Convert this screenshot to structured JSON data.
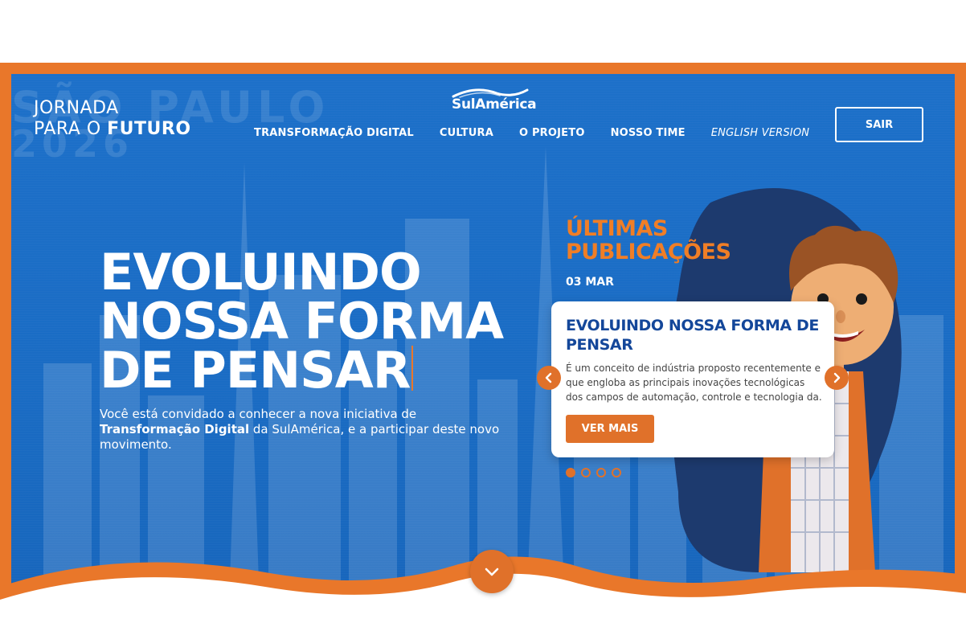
{
  "brand": {
    "line1": "JORNADA",
    "line2_prefix": "PARA O ",
    "line2_bold": "FUTURO"
  },
  "background_text": {
    "line1": "SÃO PAULO",
    "line2": "2026"
  },
  "logo": {
    "name": "SulAmérica"
  },
  "nav": {
    "items": [
      "TRANSFORMAÇÃO DIGITAL",
      "CULTURA",
      "O PROJETO",
      "NOSSO TIME"
    ],
    "english": "ENGLISH VERSION"
  },
  "sair_label": "SAIR",
  "hero": {
    "headline": [
      "EVOLUINDO",
      "NOSSA FORMA",
      "DE PENSAR"
    ],
    "intro_before": "Você está convidado a conhecer a nova iniciativa de ",
    "intro_bold": "Transformação Digital",
    "intro_after": " da SulAmérica, e a participar deste novo movimento."
  },
  "publications": {
    "title_line1": "ÚLTIMAS",
    "title_line2": "PUBLICAÇÕES",
    "date": "03 MAR",
    "card_title": "EVOLUINDO NOSSA FORMA DE PENSAR",
    "card_text": "É um conceito de indústria proposto recentemente e que engloba as principais inovações tecnológicas dos campos de automação, controle e tecnologia da.",
    "button": "VER MAIS",
    "slides_total": 4,
    "active_slide": 1
  },
  "colors": {
    "accent": "#e0712a",
    "primary": "#1d70c9",
    "title_blue": "#14479a"
  },
  "icons": {
    "prev": "chevron-left-icon",
    "next": "chevron-right-icon",
    "scroll": "chevron-down-icon"
  }
}
